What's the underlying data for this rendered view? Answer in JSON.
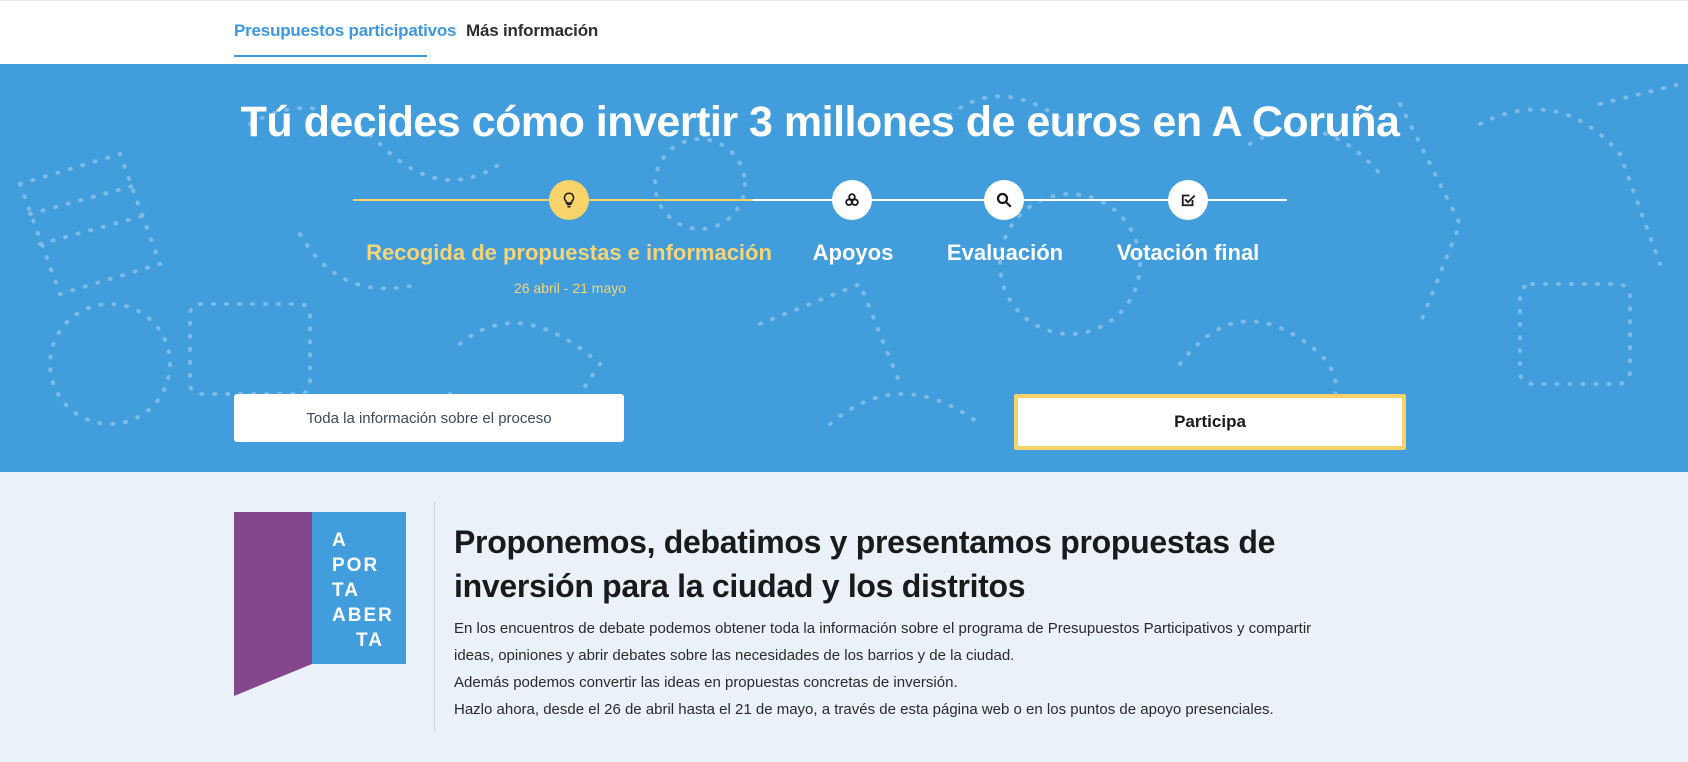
{
  "nav": {
    "tabs": [
      {
        "label": "Presupuestos participativos"
      },
      {
        "label": "Más información"
      }
    ]
  },
  "hero": {
    "title": "Tú decides cómo invertir 3 millones de euros en A Coruña",
    "steps": [
      {
        "label": "Recogida de propuestas e información",
        "icon": "lightbulb-icon",
        "date": "26 abril - 21 mayo"
      },
      {
        "label": "Apoyos",
        "icon": "coins-icon"
      },
      {
        "label": "Evaluación",
        "icon": "search-icon"
      },
      {
        "label": "Votación final",
        "icon": "check-square-icon"
      }
    ],
    "info_button": "Toda la información sobre el proceso",
    "cta_button": "Participa"
  },
  "content": {
    "logo_lines": [
      "A",
      "POR",
      "TA",
      "ABER",
      "TA"
    ],
    "heading": "Proponemos, debatimos y presentamos propuestas de inversión para la ciudad y los distritos",
    "paragraphs": [
      "En los encuentros de debate podemos obtener toda la información sobre el programa de Presupuestos Participativos y compartir ideas, opiniones y abrir debates sobre las necesidades de los barrios y de la ciudad.",
      "Además podemos convertir las ideas en propuestas concretas de inversión.",
      "Hazlo ahora, desde el 26 de abril hasta el 21 de mayo, a través de esta página web o en los puntos de apoyo presenciales."
    ]
  },
  "colors": {
    "primary_blue": "#419ddc",
    "accent_yellow": "#f5d368",
    "logo_purple": "#84478b",
    "tab_active": "#3d98de"
  }
}
